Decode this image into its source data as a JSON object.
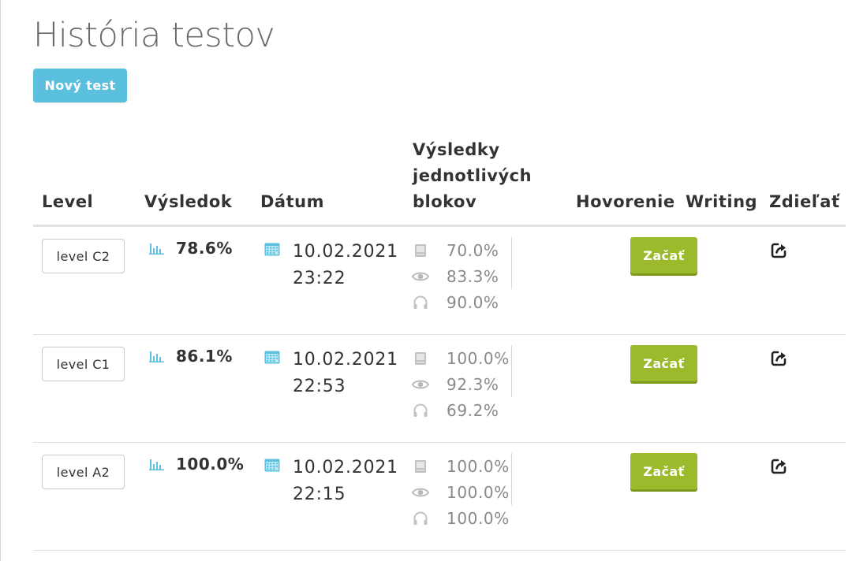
{
  "page": {
    "title": "História testov",
    "new_test_label": "Nový test"
  },
  "table": {
    "headers": {
      "level": "Level",
      "result": "Výsledok",
      "date": "Dátum",
      "blocks": "Výsledky jednotlivých blokov",
      "speaking": "Hovorenie",
      "writing": "Writing",
      "share": "Zdieľať"
    },
    "rows": [
      {
        "level": "level C2",
        "result": "78.6%",
        "date": "10.02.2021",
        "time": "23:22",
        "blocks": [
          "70.0%",
          "83.3%",
          "90.0%"
        ],
        "start_label": "Začať"
      },
      {
        "level": "level C1",
        "result": "86.1%",
        "date": "10.02.2021",
        "time": "22:53",
        "blocks": [
          "100.0%",
          "92.3%",
          "69.2%"
        ],
        "start_label": "Začať"
      },
      {
        "level": "level A2",
        "result": "100.0%",
        "date": "10.02.2021",
        "time": "22:15",
        "blocks": [
          "100.0%",
          "100.0%",
          "100.0%"
        ],
        "start_label": "Začať"
      }
    ]
  },
  "icons": {
    "result": "bar-chart-icon",
    "date": "calendar-icon",
    "blocks": [
      "book-icon",
      "eye-icon",
      "headphones-icon"
    ],
    "share": "share-icon"
  },
  "colors": {
    "info": "#5bc0de",
    "success": "#9bbb2c",
    "icon_blue": "#5bc0de",
    "muted": "#8a8a8a"
  }
}
